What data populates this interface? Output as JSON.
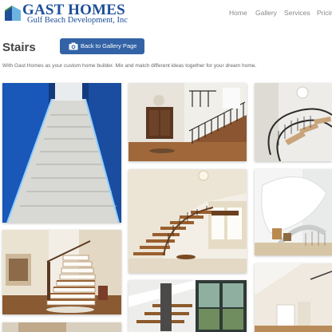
{
  "header": {
    "logo_title": "GAST HOMES",
    "logo_subtitle": "Gulf Beach Development, Inc",
    "nav": [
      {
        "label": "Home"
      },
      {
        "label": "Gallery"
      },
      {
        "label": "Services"
      },
      {
        "label": "Pricing"
      }
    ]
  },
  "page": {
    "title": "Stairs",
    "back_button_label": "Back to Gallery Page",
    "intro": "With Gast Homes as your custom home builder. Mix and match different ideas together for your dream home."
  },
  "gallery": {
    "images": [
      {
        "name": "stairs-photo-blue-lit-staircase"
      },
      {
        "name": "stairs-photo-foyer-iron-railing"
      },
      {
        "name": "stairs-photo-spiral-dark"
      },
      {
        "name": "stairs-photo-curved-wood-iron"
      },
      {
        "name": "stairs-photo-white-spiral"
      },
      {
        "name": "stairs-photo-wood-white-open"
      },
      {
        "name": "stairs-photo-modern-glass-wall"
      },
      {
        "name": "stairs-photo-tall-white-room"
      }
    ]
  },
  "colors": {
    "brand": "#1e4f99",
    "button": "#3363a6",
    "nav_text": "#888888"
  }
}
